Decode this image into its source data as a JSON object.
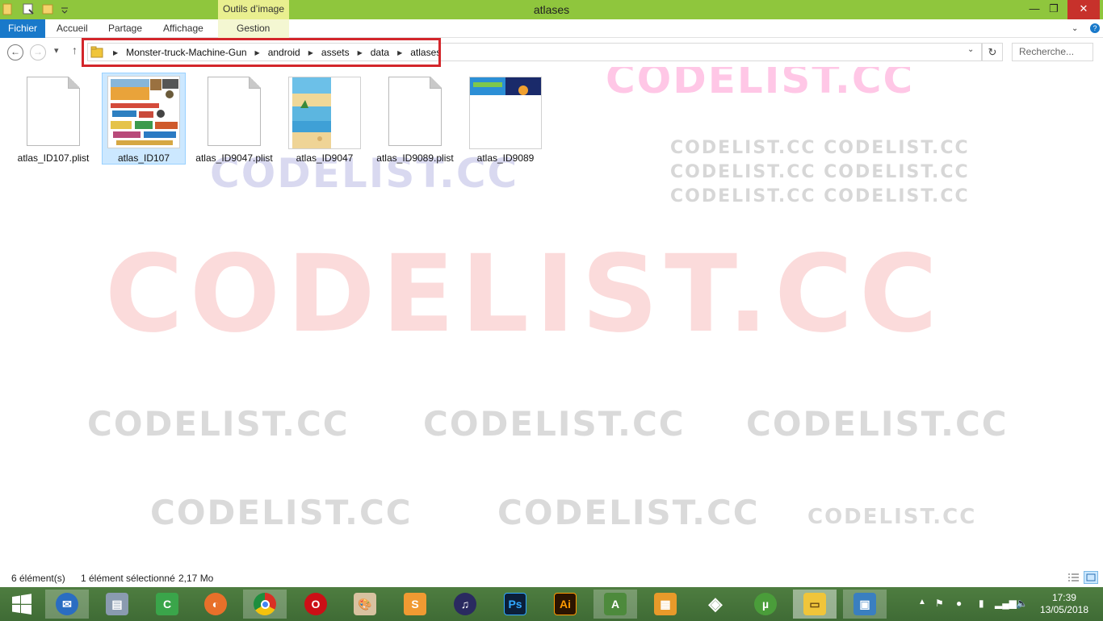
{
  "window": {
    "title": "atlases",
    "context_tab": "Outils d’image",
    "minimize": "—",
    "maximize": "❐",
    "close": "✕"
  },
  "ribbon": {
    "tabs": [
      "Fichier",
      "Accueil",
      "Partage",
      "Affichage",
      "Gestion"
    ]
  },
  "address": {
    "breadcrumbs": [
      "Monster-truck-Machine-Gun",
      "android",
      "assets",
      "data",
      "atlases"
    ],
    "search_placeholder": "Recherche..."
  },
  "files": [
    {
      "name": "atlas_ID107.plist",
      "kind": "document",
      "selected": false
    },
    {
      "name": "atlas_ID107",
      "kind": "image-atlas",
      "selected": true
    },
    {
      "name": "atlas_ID9047.plist",
      "kind": "document",
      "selected": false
    },
    {
      "name": "atlas_ID9047",
      "kind": "image-beach",
      "selected": false
    },
    {
      "name": "atlas_ID9089.plist",
      "kind": "document",
      "selected": false
    },
    {
      "name": "atlas_ID9089",
      "kind": "image-banner",
      "selected": false
    }
  ],
  "watermarks": [
    "CODELIST.CC",
    "CODELIST.CC CODELIST.CC"
  ],
  "status": {
    "count": "6 élément(s)",
    "selection": "1 élément sélectionné",
    "size": "2,17 Mo"
  },
  "taskbar": {
    "apps": [
      "start-icon",
      "thunderbird-icon",
      "file-server-icon",
      "android-studio-icon",
      "firefox-icon",
      "chrome-icon",
      "opera-icon",
      "paint-icon",
      "sublime-icon",
      "audio-icon",
      "photoshop-icon",
      "illustrator-icon",
      "android-icon",
      "package-icon",
      "unity-icon",
      "utorrent-icon",
      "file-explorer-icon",
      "photos-icon"
    ],
    "ps_label": "Ps",
    "ai_label": "Ai",
    "time": "17:39",
    "date": "13/05/2018"
  },
  "colors": {
    "titlebar": "#8fc63d",
    "file_tab": "#1979ca",
    "highlight": "#d3262b",
    "selection": "#cce8ff"
  }
}
